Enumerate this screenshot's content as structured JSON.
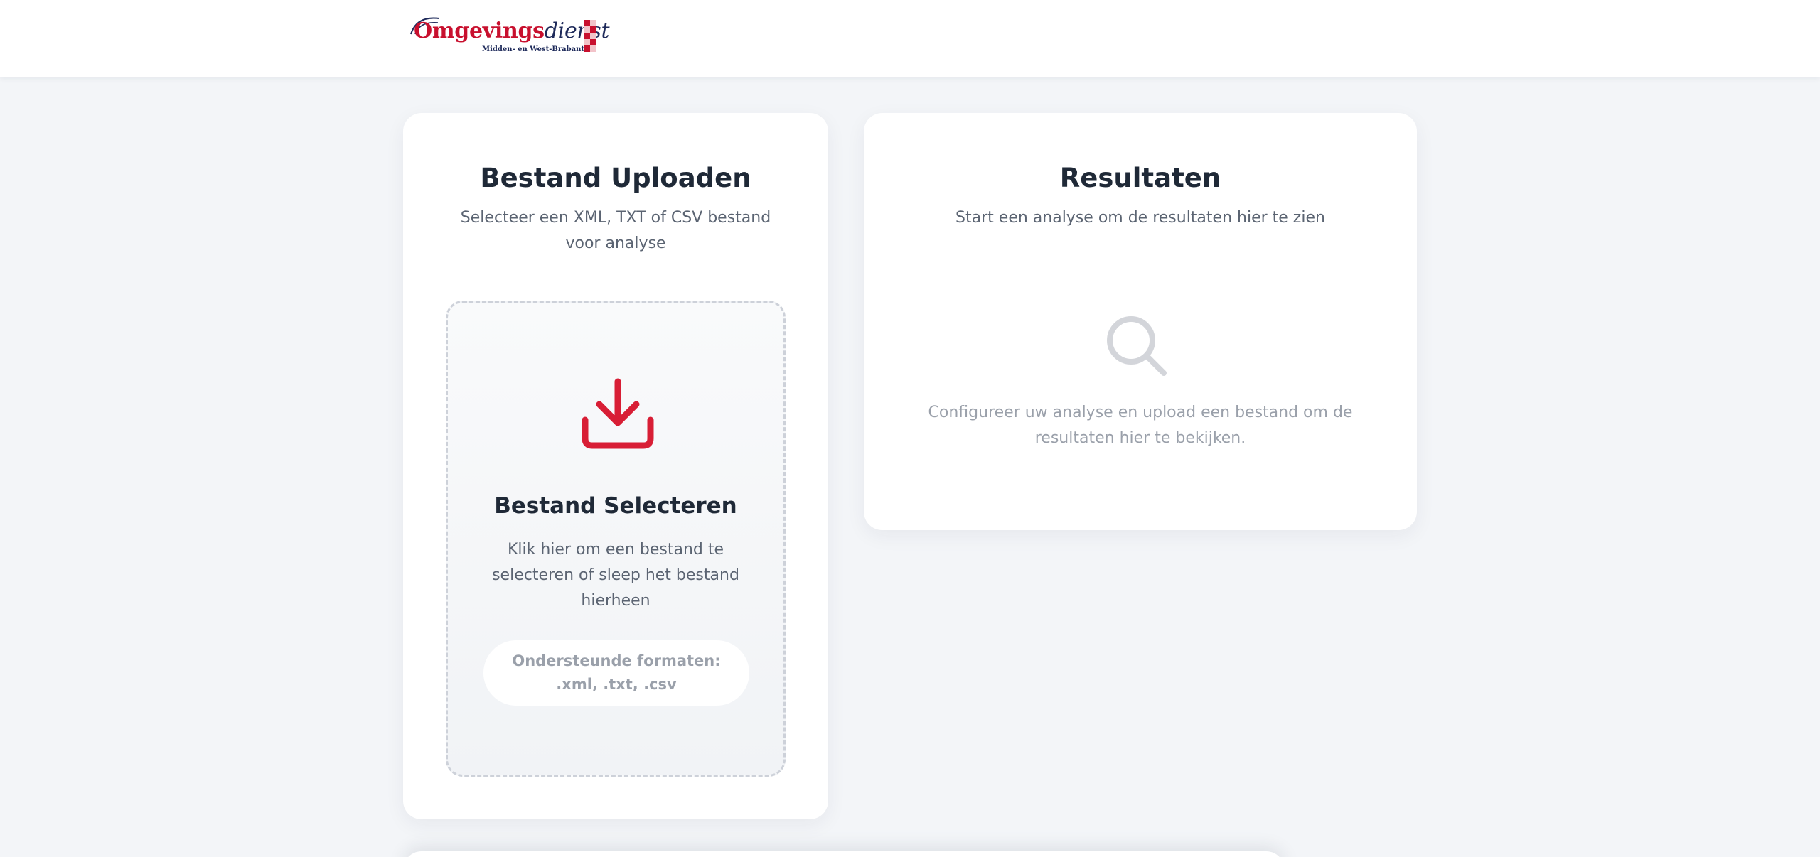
{
  "header": {
    "logo_name_part1": "Omgevings",
    "logo_name_part2": "dienst",
    "logo_region": "Midden- en West-Brabant"
  },
  "upload": {
    "title": "Bestand Uploaden",
    "subtitle": "Selecteer een XML, TXT of CSV bestand voor analyse",
    "dropzone": {
      "icon": "upload-icon",
      "title": "Bestand Selecteren",
      "text": "Klik hier om een bestand te selecteren of sleep het bestand hierheen",
      "formats": "Ondersteunde formaten: .xml, .txt, .csv"
    }
  },
  "results": {
    "title": "Resultaten",
    "subtitle": "Start een analyse om de resultaten hier te zien",
    "empty_icon": "search-icon",
    "empty_text": "Configureer uw analyse en upload een bestand om de resultaten hier te bekijken."
  },
  "colors": {
    "brand_red": "#d81e35",
    "brand_navy": "#1e2a5a",
    "page_bg": "#f3f5f8",
    "icon_muted": "#d3d5da"
  }
}
